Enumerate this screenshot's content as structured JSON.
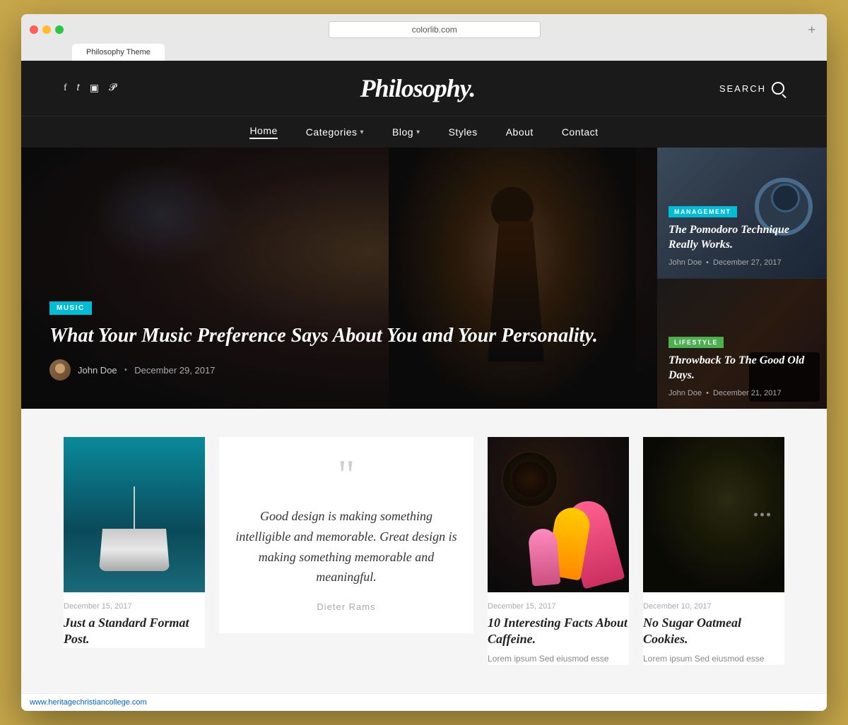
{
  "browser": {
    "url": "colorlib.com",
    "tab_label": "Philosophy Theme"
  },
  "site": {
    "title": "Philosophy.",
    "search_label": "SEARCH"
  },
  "social": [
    {
      "icon": "facebook",
      "symbol": "f"
    },
    {
      "icon": "twitter",
      "symbol": "𝕥"
    },
    {
      "icon": "instagram",
      "symbol": "◻"
    },
    {
      "icon": "pinterest",
      "symbol": "𝓟"
    }
  ],
  "nav": {
    "items": [
      {
        "label": "Home",
        "active": true
      },
      {
        "label": "Categories",
        "has_dropdown": true
      },
      {
        "label": "Blog",
        "has_dropdown": true
      },
      {
        "label": "Styles"
      },
      {
        "label": "About"
      },
      {
        "label": "Contact"
      }
    ]
  },
  "hero": {
    "category_badge": "MUSIC",
    "title": "What Your Music Preference Says About You and Your Personality.",
    "author": "John Doe",
    "date": "December 29, 2017"
  },
  "sidebar_articles": [
    {
      "category": "MANAGEMENT",
      "category_type": "management",
      "title": "The Pomodoro Technique Really Works.",
      "author": "John Doe",
      "date": "December 27, 2017"
    },
    {
      "category": "LIFESTYLE",
      "category_type": "lifestyle",
      "title": "Throwback To The Good Old Days.",
      "author": "John Doe",
      "date": "December 21, 2017"
    }
  ],
  "blog_posts": [
    {
      "type": "image_lamp",
      "date": "December 15, 2017",
      "title": "Just a Standard Format Post.",
      "excerpt": ""
    },
    {
      "type": "quote",
      "quote_text": "Good design is making something intelligible and memorable. Great design is making something memorable and meaningful.",
      "quote_author": "Dieter Rams"
    },
    {
      "type": "image_coffee",
      "date": "December 15, 2017",
      "title": "10 Interesting Facts About Caffeine.",
      "excerpt": "Lorem ipsum Sed eiusmod esse"
    },
    {
      "type": "image_dark",
      "date": "December 10, 2017",
      "title": "No Sugar Oatmeal Cookies.",
      "excerpt": "Lorem ipsum Sed eiusmod esse"
    }
  ],
  "footer_url": "www.heritagechristiancollege.com"
}
